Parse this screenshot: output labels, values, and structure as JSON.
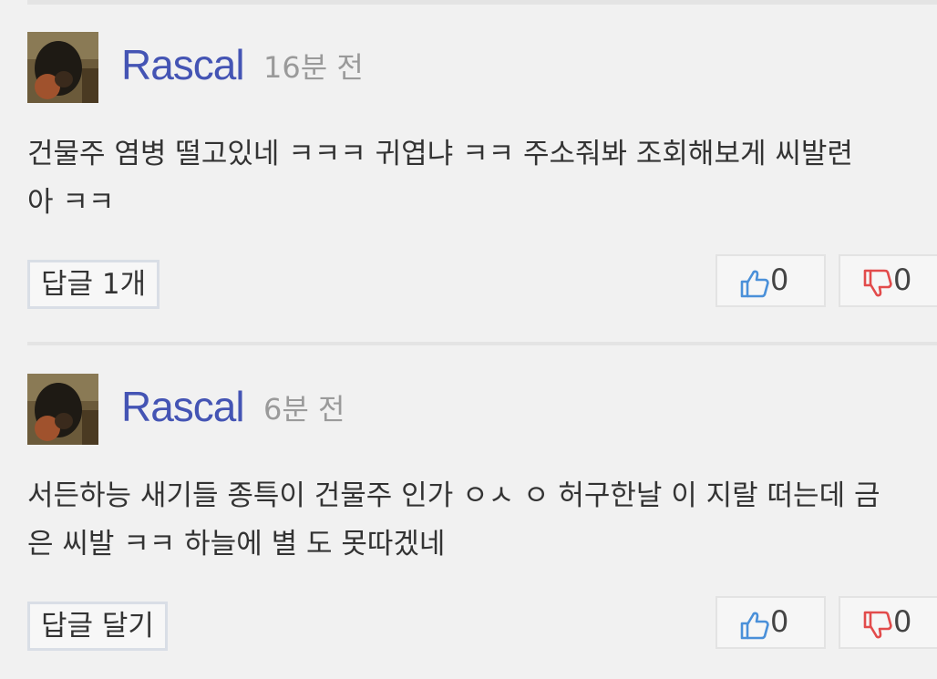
{
  "comments": [
    {
      "username": "Rascal",
      "time": "16분 전",
      "body_line1": "건물주 염병 떨고있네 ㅋㅋㅋ 귀엽냐 ㅋㅋ 주소줘봐 조회해보게 씨발련",
      "body_line2": "아 ㅋㅋ",
      "reply_label": "답글 1개",
      "likes": "0",
      "dislikes": "0"
    },
    {
      "username": "Rascal",
      "time": "6분 전",
      "body_line1": "서든하능 새기들 종특이 건물주 인가 ㅇㅅ ㅇ 허구한날 이 지랄 떠는데 금",
      "body_line2": "은 씨발 ㅋㅋ 하늘에 별 도 못따겠네",
      "reply_label": "답글 달기",
      "likes": "0",
      "dislikes": "0"
    }
  ],
  "icons": {
    "like": "thumbs-up-icon",
    "dislike": "thumbs-down-icon"
  },
  "colors": {
    "username": "#4454b4",
    "like_icon": "#4a90d9",
    "dislike_icon": "#e24b4b",
    "time": "#9a9a9a"
  }
}
